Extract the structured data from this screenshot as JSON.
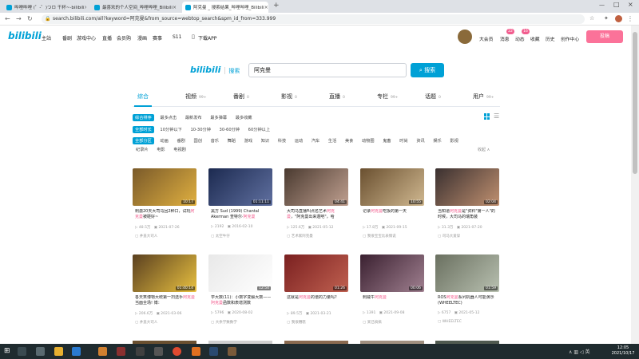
{
  "browser": {
    "tabs": [
      {
        "title": "哔哩哔哩 (゜-゜)つロ 干杯~-bilibili",
        "color": "#00a1d6"
      },
      {
        "title": "最喜欢的个人空间_哔哩哔哩_Bilibili",
        "color": "#00a1d6"
      },
      {
        "title": "阿克曼 _ 搜索结果_哔哩哔哩_Bilibili",
        "color": "#00a1d6"
      }
    ],
    "url": "search.bilibili.com/all?keyword=阿克曼&from_source=webtop_search&spm_id_from=333.999"
  },
  "header": {
    "logo": "bilibili",
    "nav": [
      "主站",
      "番剧",
      "游戏中心",
      "直播",
      "会员购",
      "漫画",
      "赛事",
      "S11",
      "下载APP"
    ],
    "right": [
      "大会员",
      "消息",
      "动态",
      "收藏",
      "历史",
      "创作中心"
    ],
    "badges": {
      "msg": "22",
      "dyn": "16"
    },
    "upload": "投稿"
  },
  "search": {
    "logo": "bilibili",
    "logo_suffix": "搜索",
    "query": "阿克曼",
    "button": "搜索"
  },
  "type_tabs": [
    {
      "label": "综合",
      "count": ""
    },
    {
      "label": "视频",
      "count": "99+"
    },
    {
      "label": "番剧",
      "count": "0"
    },
    {
      "label": "影视",
      "count": "0"
    },
    {
      "label": "直播",
      "count": "0"
    },
    {
      "label": "专栏",
      "count": "99+"
    },
    {
      "label": "话题",
      "count": "0"
    },
    {
      "label": "用户",
      "count": "99+"
    }
  ],
  "filters": {
    "order": [
      "综合排序",
      "最多点击",
      "最新发布",
      "最多弹幕",
      "最多收藏"
    ],
    "duration": [
      "全部时长",
      "10分钟以下",
      "10-30分钟",
      "30-60分钟",
      "60分钟以上"
    ],
    "zones": [
      "全部分区",
      "动画",
      "番剧",
      "国创",
      "音乐",
      "舞蹈",
      "游戏",
      "知识",
      "科技",
      "运动",
      "汽车",
      "生活",
      "美食",
      "动物圈",
      "鬼畜",
      "时尚",
      "资讯",
      "娱乐",
      "影视"
    ],
    "zones2": [
      "纪录片",
      "电影",
      "电视剧"
    ],
    "collapse": "收起 ∧"
  },
  "videos": [
    {
      "title_pre": "刺激20天大司马回2种口，试玩",
      "title_hl": "阿克曼",
      "title_post": "被砸好~",
      "duration": "10:17",
      "views": "48.5万",
      "date": "2021-07-26",
      "up": "井盖大司人",
      "c1": "#7a5a2a",
      "c2": "#e0b040"
    },
    {
      "title_pre": "黑方 Sud (1999) Chantal Akerman 查特尔·",
      "title_hl": "阿克曼",
      "title_post": "",
      "duration": "01:11:11",
      "views": "2192",
      "date": "2016-02-10",
      "up": "太空牛仔",
      "c1": "#1c2a50",
      "c2": "#6070a0"
    },
    {
      "title_pre": "大司马直播叫点名艺术",
      "title_hl": "阿克曼",
      "title_post": "，\"阿克曼出来遛吧\"，哈",
      "duration": "04:41",
      "views": "125.6万",
      "date": "2021-05-12",
      "up": "艺术家阿克曼",
      "c1": "#4a3a30",
      "c2": "#c0a090"
    },
    {
      "title_pre": "记录",
      "title_hl": "阿克曼",
      "title_post": "吃饭的第一天",
      "duration": "10:55",
      "views": "17.8万",
      "date": "2021-09-15",
      "up": "我很宝宝比表情说",
      "c1": "#6a5030",
      "c2": "#d0b890"
    },
    {
      "title_pre": "当知道",
      "title_hl": "阿克曼",
      "title_post": "是\"资料\"第一人\"的时候，大司马的瑞角装",
      "duration": "02:04",
      "views": "31.3万",
      "date": "2021-07-20",
      "up": "司马大爱穿",
      "c1": "#3a3030",
      "c2": "#c09070"
    },
    {
      "title_pre": "各天笑博物大统第一扫选手",
      "title_hl": "阿克曼",
      "title_post": "当面全场! 博：",
      "duration": "01:40:14",
      "views": "206.6万",
      "date": "2021-03-06",
      "up": "井盖大司人",
      "c1": "#5a4020",
      "c2": "#e8c040"
    },
    {
      "title_pre": "学大数(11)：小数字变解大数——",
      "title_hl": "阿克曼",
      "title_post": "函数和表增测数",
      "duration": "12:54",
      "views": "5796",
      "date": "2020-08-02",
      "up": "大余学数数学",
      "c1": "#e8e8e8",
      "c2": "#ffffff"
    },
    {
      "title_pre": "这就是",
      "title_hl": "阿克曼",
      "title_post": "的谱的力量吗?",
      "duration": "01:26",
      "views": "89.5万",
      "date": "2021-03-21",
      "up": "我很糟糕",
      "c1": "#7a2020",
      "c2": "#c06050"
    },
    {
      "title_pre": "刺威牛",
      "title_hl": "阿克曼",
      "title_post": "",
      "duration": "00:06",
      "views": "1391",
      "date": "2021-09-08",
      "up": "某已搞搞",
      "c1": "#3a2030",
      "c2": "#a08090"
    },
    {
      "title_pre": "ROS",
      "title_hl": "阿克曼",
      "title_post": "系列机器人可能演示(WHEELTEC)",
      "duration": "01:59",
      "views": "6757",
      "date": "2021-05-12",
      "up": "WHEELTEC",
      "c1": "#6a7060",
      "c2": "#b8c0b0"
    }
  ],
  "taskbar": {
    "time": "12:05",
    "date": "2021/10/17"
  },
  "colors": {
    "accent": "#00a1d6",
    "pink": "#fb7299",
    "highlight": "#f25d8e"
  }
}
